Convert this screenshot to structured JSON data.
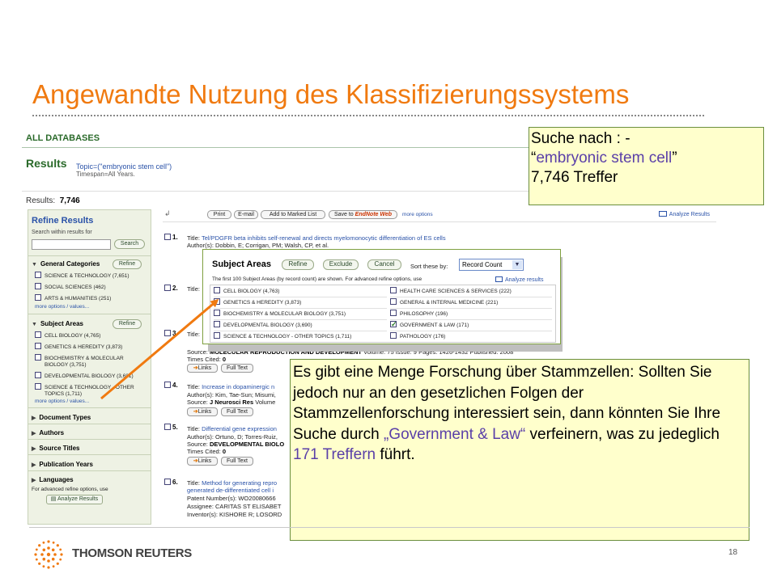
{
  "slide": {
    "title": "Angewandte Nutzung des Klassifizierungssystems",
    "page_number": "18",
    "logo_text": "THOMSON REUTERS"
  },
  "screenshot": {
    "databases_label": "ALL DATABASES",
    "results_heading": "Results",
    "query": "Topic=(\"embryonic stem cell\")",
    "timespan": "Timespan=All Years.",
    "results_label": "Results:",
    "results_count": "7,746"
  },
  "refine": {
    "heading": "Refine Results",
    "search_within": "Search within results for",
    "search_button": "Search",
    "refine_button": "Refine",
    "general_categories": "General Categories",
    "general_items": [
      "SCIENCE & TECHNOLOGY (7,651)",
      "SOCIAL SCIENCES (462)",
      "ARTS & HUMANITIES (251)"
    ],
    "more_options": "more options / values...",
    "subject_areas": "Subject Areas",
    "subject_items": [
      "CELL BIOLOGY (4,765)",
      "GENETICS & HEREDITY (3,873)",
      "BIOCHEMISTRY & MOLECULAR BIOLOGY (3,751)",
      "DEVELOPMENTAL BIOLOGY (3,681)",
      "SCIENCE & TECHNOLOGY - OTHER TOPICS (1,711)"
    ],
    "collapsed": [
      "Document Types",
      "Authors",
      "Source Titles",
      "Publication Years",
      "Languages"
    ],
    "note": "For advanced refine options, use",
    "analyze_button": "Analyze Results"
  },
  "toolbar": {
    "print": "Print",
    "email": "E-mail",
    "marked_list": "Add to Marked List",
    "save_to": "Save to",
    "endnote": "EndNote Web",
    "more_options": "more options",
    "analyze": "Analyze Results"
  },
  "records": [
    {
      "num": "1.",
      "title_label": "Title:",
      "title": "Tel/PDGFR beta inhibits self-renewal and directs myelomonocytic differentiation of ES cells",
      "authors": "Author(s): Dobbin, E; Corrigan, PM; Walsh, CP, et al."
    },
    {
      "num": "2.",
      "title_label": "Title:"
    },
    {
      "num": "3.",
      "title_label": "Title:",
      "source_label": "Source:",
      "source": "MOLECULAR REPRODUCTION AND DEVELOPMENT",
      "source_detail": "Volume: 75  Issue: 9  Pages: 1426-1432  Published: 2008",
      "times_cited_label": "Times Cited:",
      "times_cited": "0"
    },
    {
      "num": "4.",
      "title_label": "Title:",
      "title": "Increase in dopaminergic n",
      "authors": "Author(s): Kim, Tae-Sun; Misumi,",
      "source_label": "Source:",
      "source": "J Neurosci Res",
      "source_detail": "Volume"
    },
    {
      "num": "5.",
      "title_label": "Title:",
      "title": "Differential gene expression",
      "authors": "Author(s): Ortuno, D; Torres-Ruiz,",
      "source_label": "Source:",
      "source": "DEVELOPMENTAL BIOLO",
      "times_cited_label": "Times Cited:",
      "times_cited": "0"
    },
    {
      "num": "6.",
      "title_label": "Title:",
      "title": "Method for generating repro",
      "title2": "generated de-differentiated cell i",
      "patent": "Patent Number(s): WO20080666",
      "assignee": "Assignee: CARITAS ST ELISABET",
      "inventor": "Inventor(s): KISHORE R; LOSORD"
    }
  ],
  "links_button": "Links",
  "fulltext_button": "Full Text",
  "subject_popup": {
    "title": "Subject Areas",
    "refine": "Refine",
    "exclude": "Exclude",
    "cancel": "Cancel",
    "sort_label": "Sort these by:",
    "sort_value": "Record Count",
    "info": "The first 100 Subject Areas (by record count) are shown. For advanced refine options, use",
    "analyze": "Analyze results",
    "left": [
      "CELL BIOLOGY (4,763)",
      "GENETICS & HEREDITY (3,873)",
      "BIOCHEMISTRY & MOLECULAR BIOLOGY (3,751)",
      "DEVELOPMENTAL BIOLOGY (3,690)",
      "SCIENCE & TECHNOLOGY - OTHER TOPICS (1,711)"
    ],
    "right": [
      "HEALTH CARE SCIENCES & SERVICES (222)",
      "GENERAL & INTERNAL MEDICINE (221)",
      "PHILOSOPHY (196)",
      "GOVERNMENT & LAW (171)",
      "PATHOLOGY (176)"
    ]
  },
  "callout1": {
    "line1": "Suche nach :  -",
    "quote_open": "“",
    "term": "embryonic stem cell",
    "quote_close": "”",
    "line3": "7,746 Treffer"
  },
  "callout2": {
    "part1": "Es gibt eine Menge  Forschung über Stammzellen: Sollten Sie jedoch nur an den gesetzlichen Folgen der Stammzellenforschung interessiert sein,  dann könnten Sie Ihre Suche durch ",
    "hl1": "„Government & Law“",
    "part2": " verfeinern, was zu jedeglich ",
    "hl2": "171 Treffern",
    "part3": " führt."
  },
  "colors": {
    "title_orange": "#f07a10",
    "callout_bg": "#ffffcc",
    "highlight": "#5a3fa8",
    "link_blue": "#2a52a8",
    "arrow": "#f07a10"
  }
}
